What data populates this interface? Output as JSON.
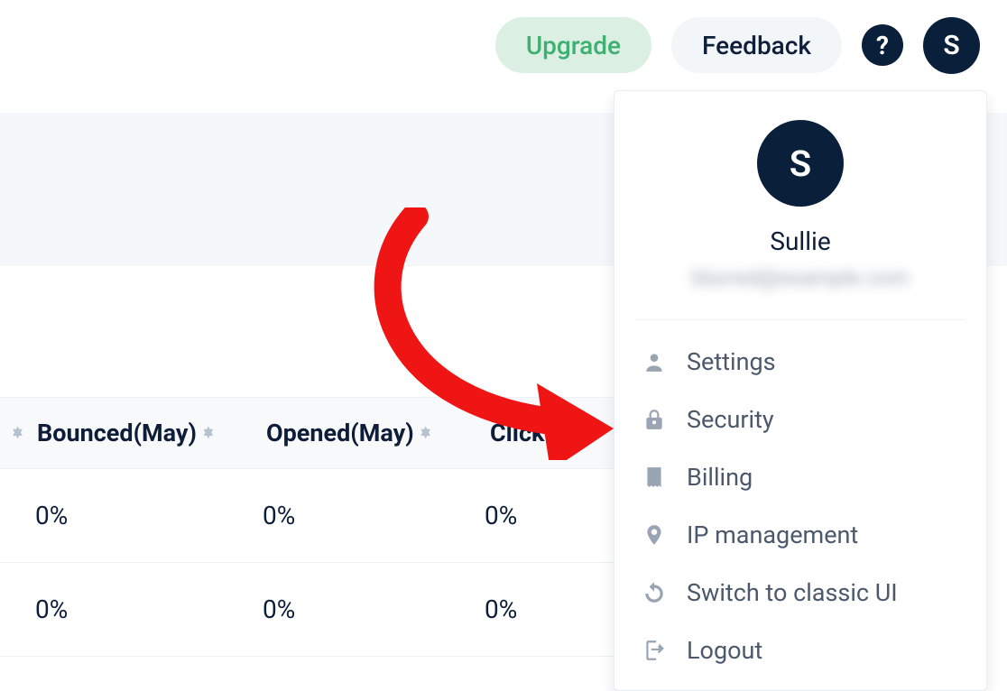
{
  "header": {
    "upgrade_label": "Upgrade",
    "feedback_label": "Feedback",
    "help_label": "?",
    "avatar_initial": "S"
  },
  "table": {
    "columns": [
      {
        "label": "Bounced(May)"
      },
      {
        "label": "Opened(May)"
      },
      {
        "label": "Click"
      }
    ],
    "rows": [
      [
        "0%",
        "0%",
        "0%"
      ],
      [
        "0%",
        "0%",
        "0%"
      ]
    ]
  },
  "menu": {
    "avatar_initial": "S",
    "username": "Sullie",
    "email_placeholder": "blurred@example.com",
    "items": [
      {
        "icon": "user",
        "label": "Settings"
      },
      {
        "icon": "lock",
        "label": "Security"
      },
      {
        "icon": "receipt",
        "label": "Billing"
      },
      {
        "icon": "pin",
        "label": "IP management"
      },
      {
        "icon": "refresh",
        "label": "Switch to classic UI"
      },
      {
        "icon": "logout",
        "label": "Logout"
      }
    ]
  }
}
